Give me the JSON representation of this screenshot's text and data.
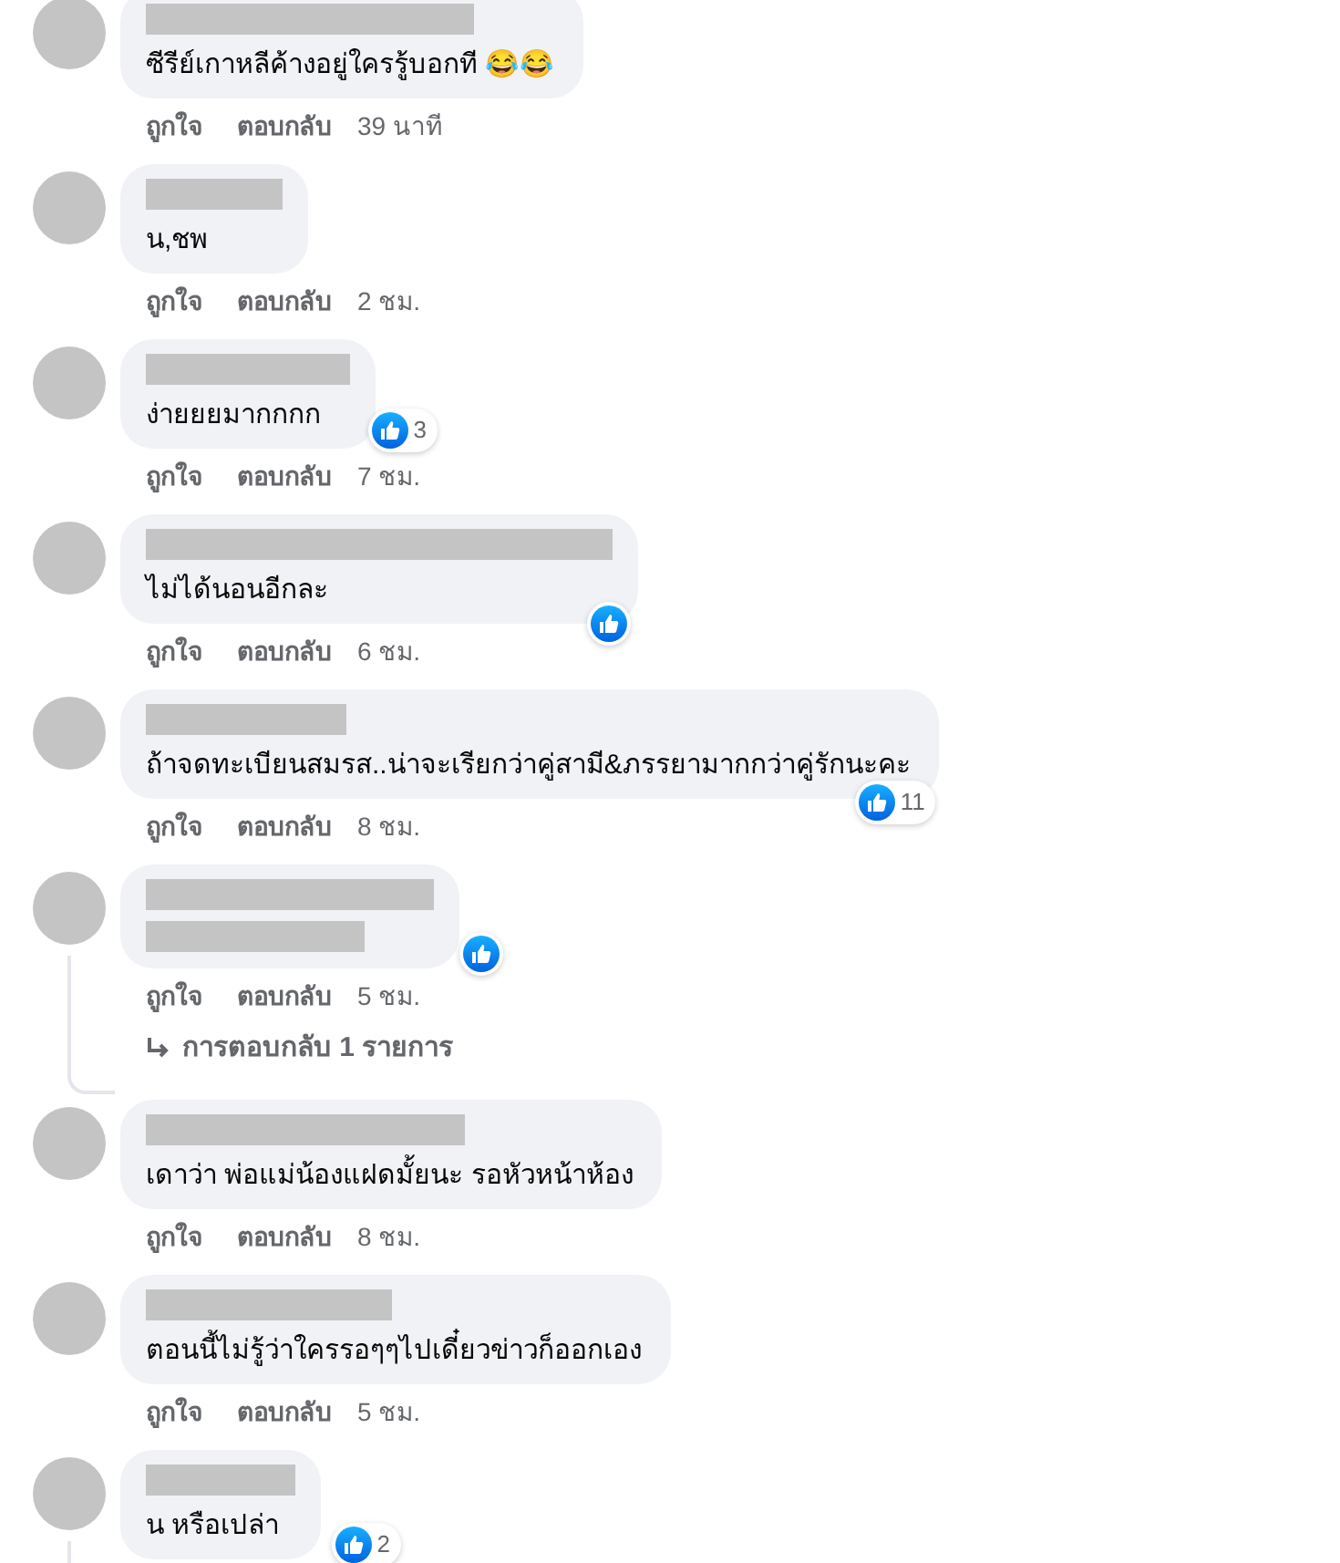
{
  "comments": [
    {
      "text": "ซีรีย์เกาหลีค้างอยู่ใครรู้บอกที 😂😂",
      "like": "ถูกใจ",
      "reply": "ตอบกลับ",
      "time": "39 นาที"
    },
    {
      "text": "น,ชพ",
      "like": "ถูกใจ",
      "reply": "ตอบกลับ",
      "time": "2 ชม."
    },
    {
      "text": "ง่ายยยมากกกก",
      "like": "ถูกใจ",
      "reply": "ตอบกลับ",
      "time": "7 ชม.",
      "reacted": true,
      "reaction_count": "3"
    },
    {
      "text": "ไม่ได้นอนอีกละ",
      "like": "ถูกใจ",
      "reply": "ตอบกลับ",
      "time": "6 ชม.",
      "reacted": true
    },
    {
      "text": "ถ้าจดทะเบียนสมรส..น่าจะเรียกว่าคู่สามี&ภรรยามากกว่าคู่รักนะคะ",
      "like": "ถูกใจ",
      "reply": "ตอบกลับ",
      "time": "8 ชม.",
      "reacted": true,
      "reaction_count": "11"
    },
    {
      "text_redacted": true,
      "like": "ถูกใจ",
      "reply": "ตอบกลับ",
      "time": "5 ชม.",
      "reacted": true,
      "replies_link": "การตอบกลับ 1 รายการ"
    },
    {
      "text": "เดาว่า พ่อแม่น้องแฝดมั้ยนะ รอหัวหน้าห้อง",
      "like": "ถูกใจ",
      "reply": "ตอบกลับ",
      "time": "8 ชม."
    },
    {
      "text": "ตอนนี้ไม่รู้ว่าใครรอๆๆไปเดี๋ยวข่าวก็ออกเอง",
      "like": "ถูกใจ",
      "reply": "ตอบกลับ",
      "time": "5 ชม."
    },
    {
      "text": "น หรือเปล่า",
      "reacted": true,
      "reaction_count": "2",
      "has_thread": true
    }
  ]
}
